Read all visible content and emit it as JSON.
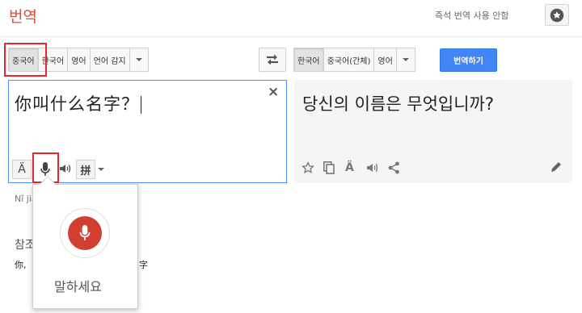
{
  "header": {
    "title": "번역",
    "instant_link": "즉석 번역 사용 안함"
  },
  "source_langs": [
    "중국어",
    "한국어",
    "영어",
    "언어 감지"
  ],
  "target_langs": [
    "한국어",
    "중국어(간체)",
    "영어"
  ],
  "translate_button": "번역하기",
  "source": {
    "text": "你叫什么名字？",
    "clear": "×",
    "tool_accent": "Ä",
    "tool_pinyin": "拼"
  },
  "target": {
    "text": "당신의 이름은 무엇입니까?",
    "icon_accent": "Ä"
  },
  "romanization": "Nǐ jiào",
  "reference": {
    "title": "참조",
    "line_start": "你,",
    "line_end": "字"
  },
  "voice": {
    "prompt": "말하세요"
  },
  "colors": {
    "accent_red": "#dd4b39",
    "highlight_red": "#e8272c",
    "button_blue": "#4285f4",
    "mic_red": "#d23f31"
  }
}
